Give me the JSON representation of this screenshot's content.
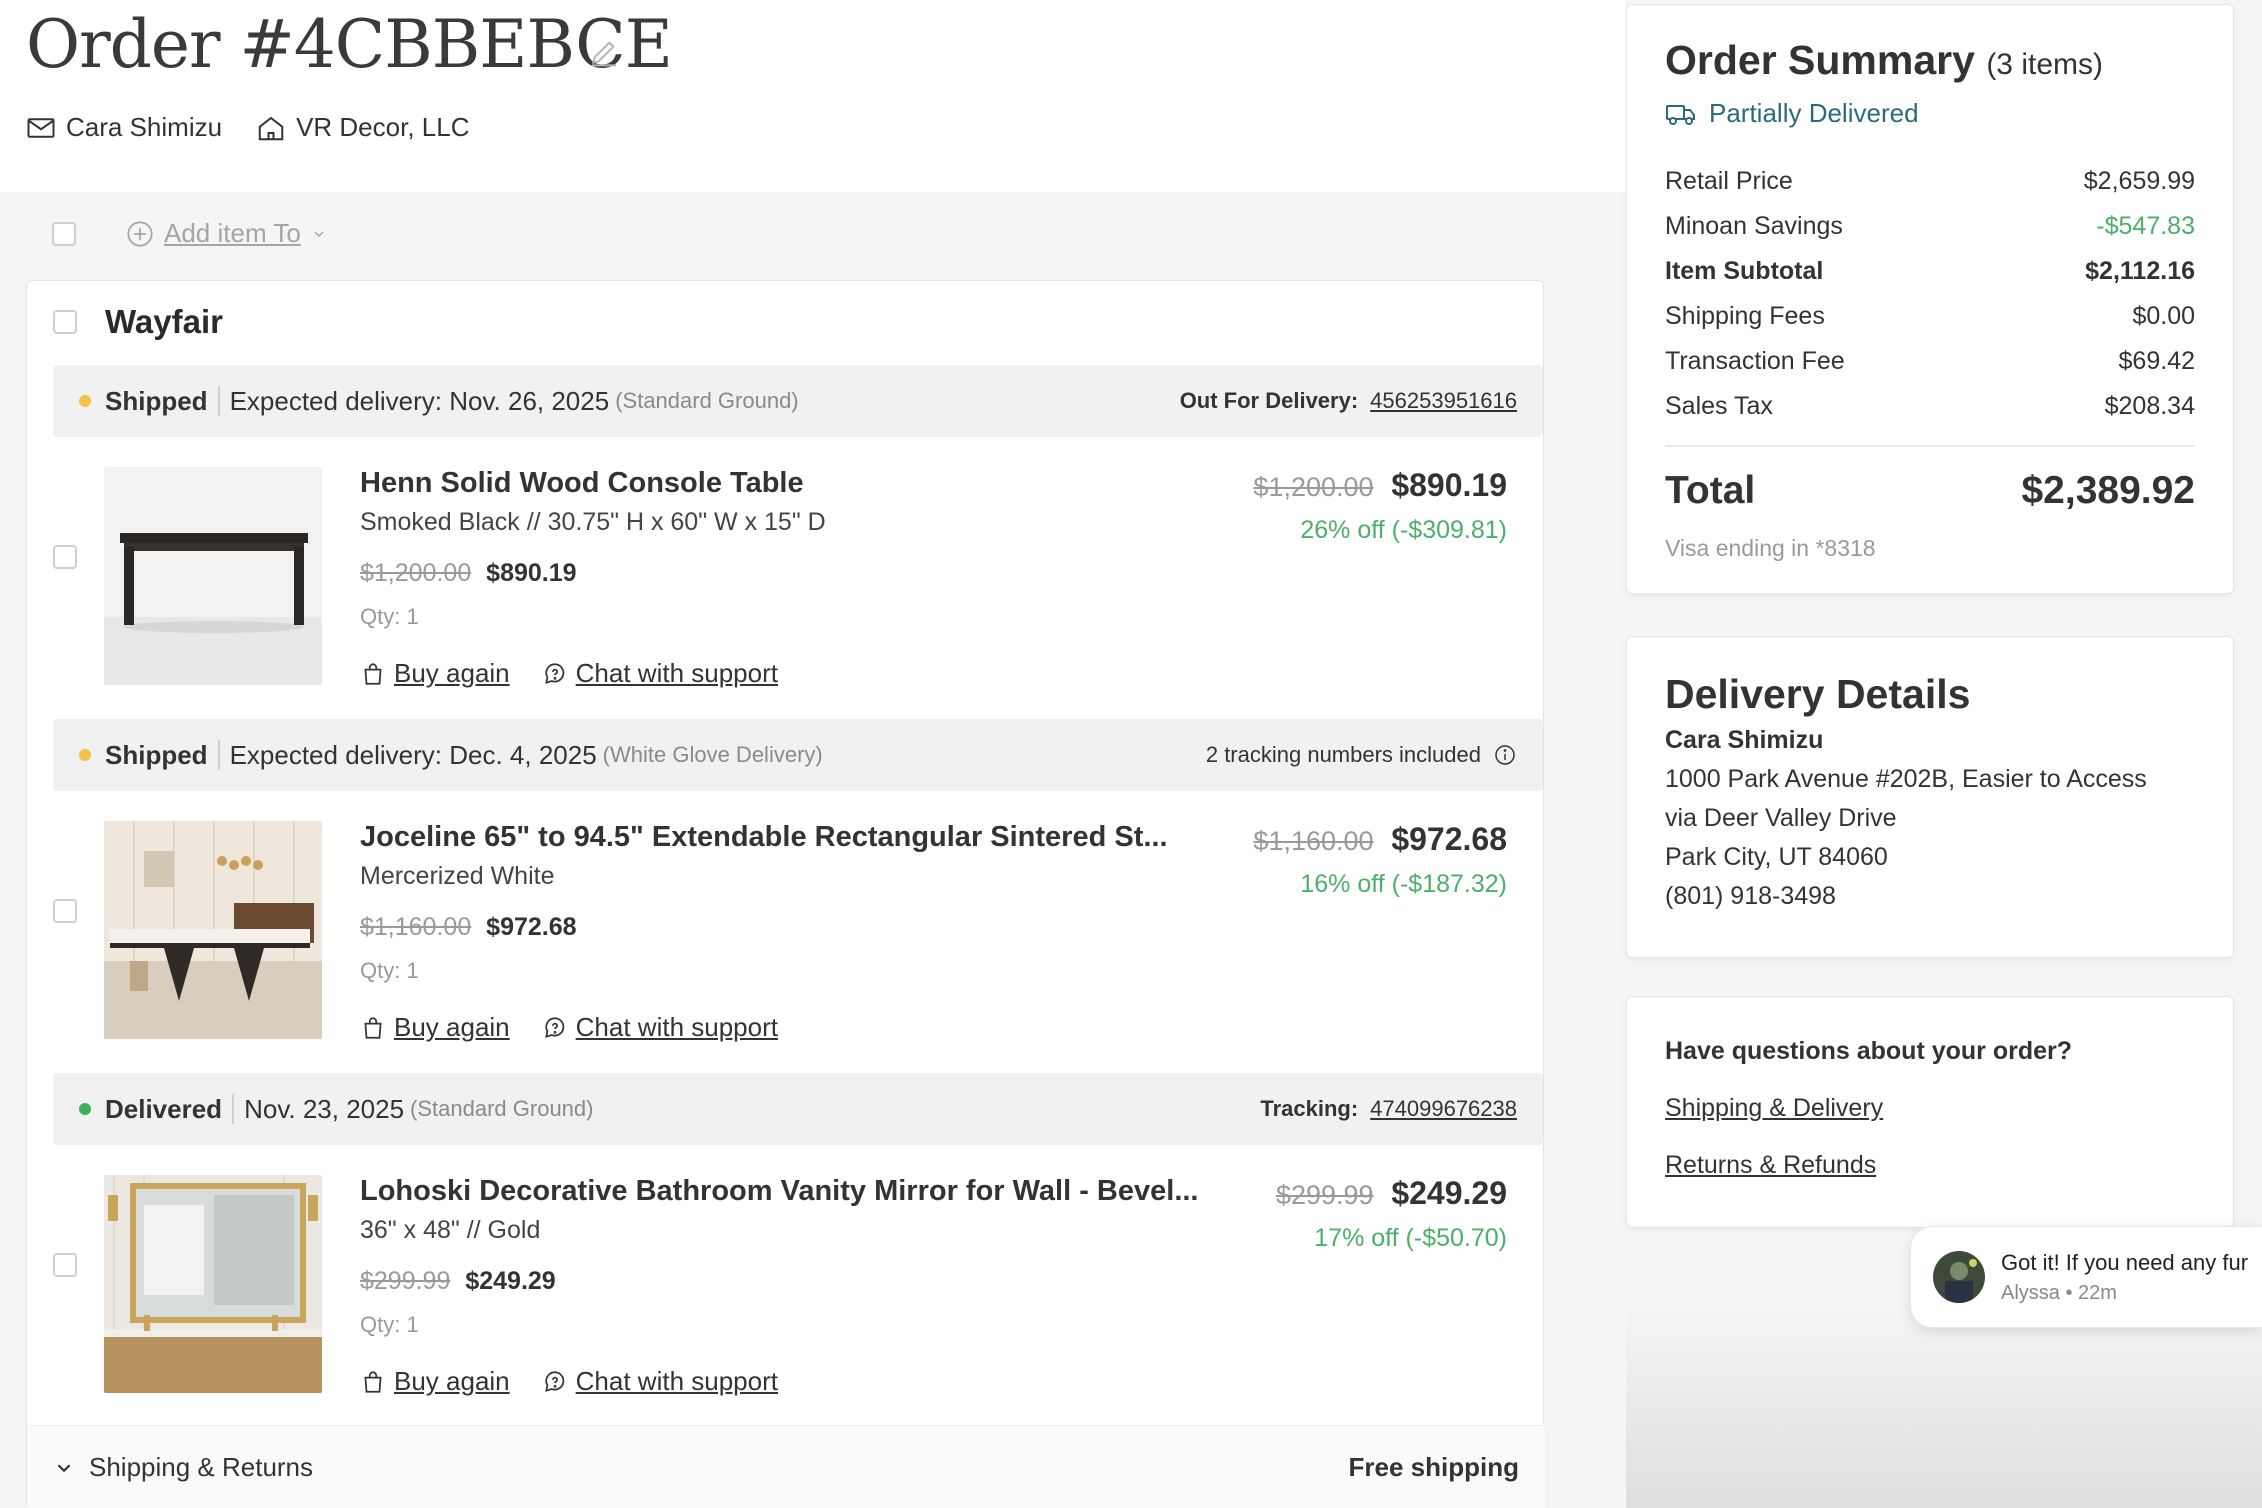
{
  "order": {
    "title": "Order #4CBBEBCE",
    "customer": "Cara Shimizu",
    "company": "VR Decor, LLC",
    "add_item_label": "Add item To"
  },
  "vendor": {
    "name": "Wayfair",
    "shipments": [
      {
        "status": "Shipped",
        "status_color": "#f0c44a",
        "date_text": "Expected delivery: Nov. 26, 2025",
        "method": "(Standard Ground)",
        "right_label": "Out For Delivery:",
        "tracking": "456253951616",
        "item": {
          "name": "Henn Solid Wood Console Table",
          "variant": "Smoked Black // 30.75\" H x 60\" W x 15\" D",
          "orig_price": "$1,200.00",
          "price": "$890.19",
          "qty": "Qty: 1",
          "discount": "26% off (-$309.81)",
          "buy_again": "Buy again",
          "chat": "Chat with support"
        }
      },
      {
        "status": "Shipped",
        "status_color": "#f0c44a",
        "date_text": "Expected delivery: Dec. 4, 2025",
        "method": "(White Glove Delivery)",
        "right_label": "2 tracking numbers included",
        "tracking": "",
        "item": {
          "name": "Joceline 65\" to 94.5\" Extendable Rectangular Sintered St...",
          "variant": "Mercerized White",
          "orig_price": "$1,160.00",
          "price": "$972.68",
          "qty": "Qty: 1",
          "discount": "16% off (-$187.32)",
          "buy_again": "Buy again",
          "chat": "Chat with support"
        }
      },
      {
        "status": "Delivered",
        "status_color": "#3fae5f",
        "date_text": "Nov. 23, 2025",
        "method": "(Standard Ground)",
        "right_label": "Tracking:",
        "tracking": "474099676238",
        "item": {
          "name": "Lohoski Decorative Bathroom Vanity Mirror for Wall - Bevel...",
          "variant": "36\" x 48\" // Gold",
          "orig_price": "$299.99",
          "price": "$249.29",
          "qty": "Qty: 1",
          "discount": "17% off (-$50.70)",
          "buy_again": "Buy again",
          "chat": "Chat with support"
        }
      }
    ],
    "footer_left": "Shipping & Returns",
    "footer_right": "Free shipping"
  },
  "summary": {
    "title": "Order Summary",
    "count": "(3 items)",
    "status": "Partially Delivered",
    "lines": [
      {
        "label": "Retail Price",
        "value": "$2,659.99"
      },
      {
        "label": "Minoan Savings",
        "value": "-$547.83"
      },
      {
        "label": "Item Subtotal",
        "value": "$2,112.16"
      },
      {
        "label": "Shipping Fees",
        "value": "$0.00"
      },
      {
        "label": "Transaction Fee",
        "value": "$69.42"
      },
      {
        "label": "Sales Tax",
        "value": "$208.34"
      }
    ],
    "total_label": "Total",
    "total_value": "$2,389.92",
    "payment": "Visa ending in *8318"
  },
  "delivery": {
    "title": "Delivery Details",
    "name": "Cara Shimizu",
    "address1": "1000 Park Avenue #202B, Easier to Access",
    "address2": "via Deer Valley Drive",
    "address3": "Park City, UT 84060",
    "phone": "(801) 918-3498"
  },
  "questions": {
    "title": "Have questions about your order?",
    "link1": "Shipping & Delivery",
    "link2": "Returns & Refunds"
  },
  "chat": {
    "message": "Got it! If you need any fur",
    "meta": "Alyssa • 22m"
  },
  "colors": {
    "accent_teal": "#2c6a7a",
    "savings_green": "#4caf6a",
    "shipped_yellow": "#f0c44a",
    "delivered_green": "#3fae5f"
  }
}
